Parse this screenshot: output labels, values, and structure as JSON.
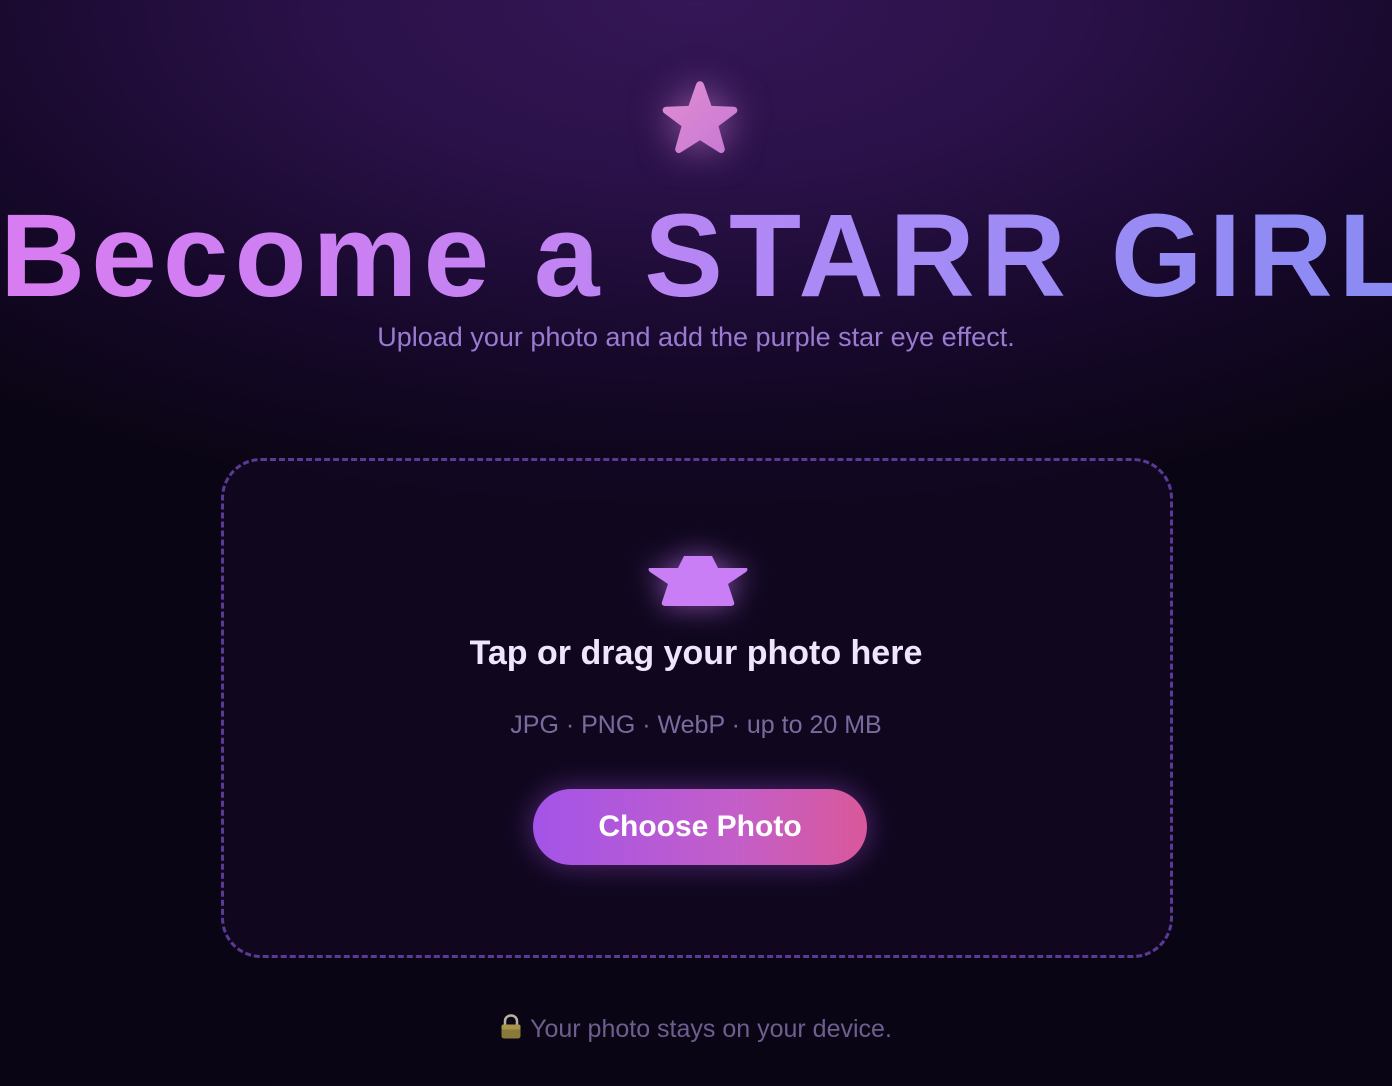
{
  "header": {
    "icon": "star-icon",
    "title": "Become a STARR GIRL",
    "subtitle": "Upload your photo and add the purple star eye effect."
  },
  "dropzone": {
    "icon": "star-eye-icon",
    "title": "Tap or drag your photo here",
    "hint": "JPG · PNG · WebP · up to 20 MB",
    "button_label": "Choose Photo"
  },
  "footer": {
    "icon": "lock-icon",
    "privacy_text": "Your photo stays on your device."
  },
  "colors": {
    "accent_start": "#a354e8",
    "accent_end": "#d9589a",
    "title_start": "#d97cf1",
    "title_end": "#8a8bf3",
    "background": "#0a0514"
  }
}
